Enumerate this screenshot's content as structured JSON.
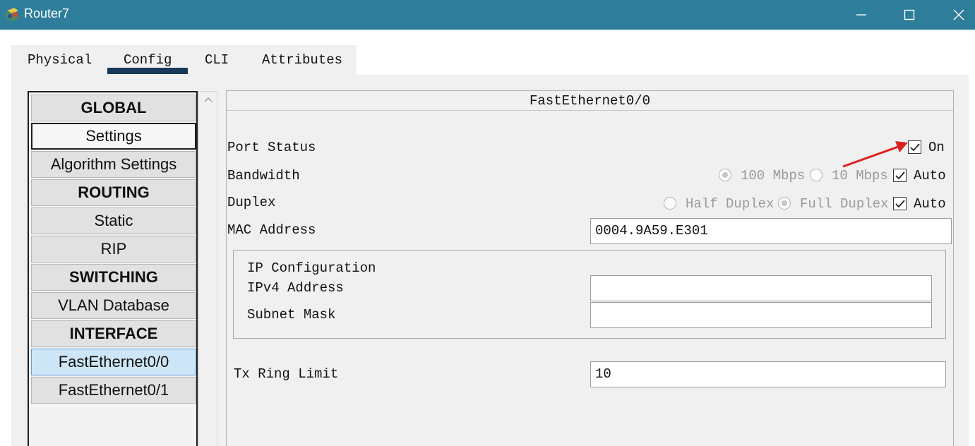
{
  "window": {
    "title": "Router7"
  },
  "tabs": [
    {
      "label": "Physical"
    },
    {
      "label": "Config"
    },
    {
      "label": "CLI"
    },
    {
      "label": "Attributes"
    }
  ],
  "nav": {
    "items": [
      {
        "label": "GLOBAL"
      },
      {
        "label": "Settings"
      },
      {
        "label": "Algorithm Settings"
      },
      {
        "label": "ROUTING"
      },
      {
        "label": "Static"
      },
      {
        "label": "RIP"
      },
      {
        "label": "SWITCHING"
      },
      {
        "label": "VLAN Database"
      },
      {
        "label": "INTERFACE"
      },
      {
        "label": "FastEthernet0/0"
      },
      {
        "label": "FastEthernet0/1"
      }
    ]
  },
  "panel": {
    "title": "FastEthernet0/0",
    "port_status": {
      "label": "Port Status",
      "on_label": "On",
      "checked": true
    },
    "bandwidth": {
      "label": "Bandwidth",
      "option1": "100 Mbps",
      "option2": "10 Mbps",
      "auto_label": "Auto",
      "auto_checked": true
    },
    "duplex": {
      "label": "Duplex",
      "option1": "Half Duplex",
      "option2": "Full Duplex",
      "auto_label": "Auto",
      "auto_checked": true
    },
    "mac": {
      "label": "MAC Address",
      "value": "0004.9A59.E301"
    },
    "ip_config": {
      "heading": "IP Configuration",
      "ipv4_label": "IPv4 Address",
      "ipv4_value": "",
      "subnet_label": "Subnet Mask",
      "subnet_value": ""
    },
    "tx_ring": {
      "label": "Tx Ring Limit",
      "value": "10"
    }
  },
  "colors": {
    "titlebar": "#2e7d9b",
    "annotation_arrow": "#e02020",
    "tab_underline": "#183a5a",
    "selected_item": "#cde6f7"
  },
  "icons": [
    "router-app-icon",
    "minimize-icon",
    "maximize-icon",
    "close-icon",
    "scroll-up-icon",
    "check-icon",
    "arrow-annotation"
  ]
}
